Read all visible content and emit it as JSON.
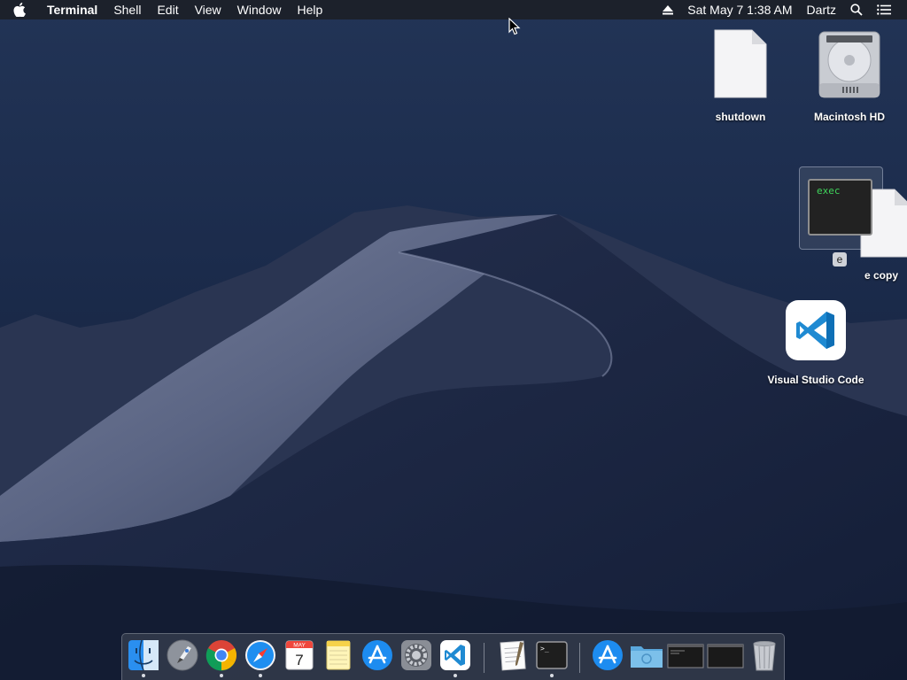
{
  "menubar": {
    "app_name": "Terminal",
    "menus": [
      "Shell",
      "Edit",
      "View",
      "Window",
      "Help"
    ],
    "clock": "Sat May 7  1:38 AM",
    "user": "Dartz"
  },
  "desktop": {
    "icons": [
      {
        "label": "shutdown"
      },
      {
        "label": "Macintosh HD"
      },
      {
        "label": "e",
        "preview_text": "exec"
      },
      {
        "label": "e copy"
      },
      {
        "label": "Visual Studio Code"
      }
    ]
  },
  "dock": {
    "calendar": {
      "month": "MAY",
      "day": "7"
    },
    "terminal_prompt": ">_",
    "items": [
      "finder-icon",
      "launchpad-icon",
      "chrome-icon",
      "safari-icon",
      "calendar-icon",
      "notes-icon",
      "app-store-icon",
      "system-preferences-icon",
      "vscode-icon",
      "textedit-icon",
      "terminal-icon",
      "app-store-downloads-icon",
      "folder-icon",
      "terminal-window-icon",
      "terminal-window-icon",
      "trash-icon"
    ]
  },
  "colors": {
    "menubar_bg": "#1c1e24",
    "vscode_blue": "#1f8ad2",
    "terminal_green": "#3fd35a"
  }
}
